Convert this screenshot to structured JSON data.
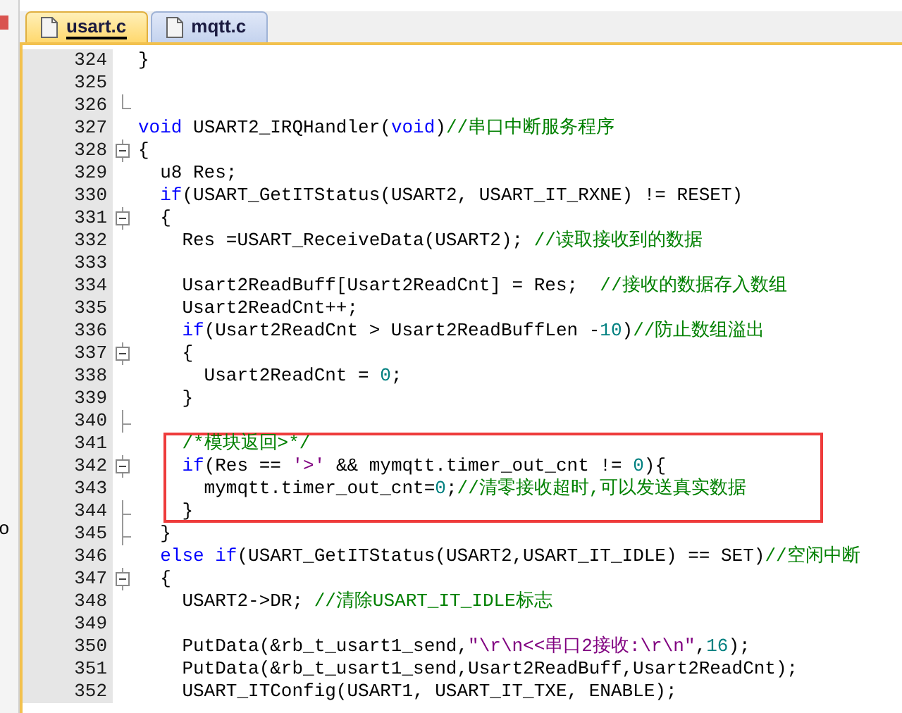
{
  "side_panel": {
    "text": "o"
  },
  "tabs": [
    {
      "label": "usart.c",
      "selected": true
    },
    {
      "label": "mqtt.c",
      "selected": false
    }
  ],
  "lines": [
    {
      "number": "324",
      "kind": "guide",
      "highlighted": false,
      "tokens": [
        {
          "kind": "plain",
          "text": "}"
        }
      ]
    },
    {
      "number": "325",
      "kind": "guide",
      "highlighted": false
    },
    {
      "number": "326",
      "kind": "end",
      "highlighted": false
    },
    {
      "number": "327",
      "kind": "plain",
      "highlighted": false,
      "tokens": [
        {
          "kind": "keyword",
          "text": "void"
        },
        {
          "kind": "plain",
          "text": " USART2_IRQHandler("
        },
        {
          "kind": "keyword",
          "text": "void"
        },
        {
          "kind": "plain",
          "text": ")"
        },
        {
          "kind": "comment",
          "text": "//串口中断服务程序"
        }
      ]
    },
    {
      "number": "328",
      "kind": "open",
      "highlighted": false,
      "tokens": [
        {
          "kind": "plain",
          "text": "{"
        }
      ]
    },
    {
      "number": "329",
      "kind": "guide",
      "highlighted": false,
      "tokens": [
        {
          "kind": "plain",
          "text": "  u8 Res;"
        }
      ]
    },
    {
      "number": "330",
      "kind": "guide",
      "highlighted": false,
      "tokens": [
        {
          "kind": "keyword",
          "text": "  if"
        },
        {
          "kind": "plain",
          "text": "(USART_GetITStatus(USART2, USART_IT_RXNE) != RESET)"
        }
      ]
    },
    {
      "number": "331",
      "kind": "open",
      "highlighted": false,
      "tokens": [
        {
          "kind": "plain",
          "text": "  {"
        }
      ]
    },
    {
      "number": "332",
      "kind": "guide",
      "highlighted": false,
      "tokens": [
        {
          "kind": "plain",
          "text": "    Res =USART_ReceiveData(USART2); "
        },
        {
          "kind": "comment",
          "text": "//读取接收到的数据"
        }
      ]
    },
    {
      "number": "333",
      "kind": "guide",
      "highlighted": false
    },
    {
      "number": "334",
      "kind": "guide",
      "highlighted": false,
      "tokens": [
        {
          "kind": "plain",
          "text": "    Usart2ReadBuff[Usart2ReadCnt] = Res;  "
        },
        {
          "kind": "comment",
          "text": "//接收的数据存入数组"
        }
      ]
    },
    {
      "number": "335",
      "kind": "guide",
      "highlighted": false,
      "tokens": [
        {
          "kind": "plain",
          "text": "    Usart2ReadCnt++;"
        }
      ]
    },
    {
      "number": "336",
      "kind": "guide",
      "highlighted": false,
      "tokens": [
        {
          "kind": "keyword",
          "text": "    if"
        },
        {
          "kind": "plain",
          "text": "(Usart2ReadCnt > Usart2ReadBuffLen -"
        },
        {
          "kind": "number",
          "text": "10"
        },
        {
          "kind": "plain",
          "text": ")"
        },
        {
          "kind": "comment",
          "text": "//防止数组溢出"
        }
      ]
    },
    {
      "number": "337",
      "kind": "open",
      "highlighted": false,
      "tokens": [
        {
          "kind": "plain",
          "text": "    {"
        }
      ]
    },
    {
      "number": "338",
      "kind": "guide",
      "highlighted": false,
      "tokens": [
        {
          "kind": "plain",
          "text": "      Usart2ReadCnt = "
        },
        {
          "kind": "number",
          "text": "0"
        },
        {
          "kind": "plain",
          "text": ";"
        }
      ]
    },
    {
      "number": "339",
      "kind": "guide",
      "highlighted": false,
      "tokens": [
        {
          "kind": "plain",
          "text": "    }"
        }
      ]
    },
    {
      "number": "340",
      "kind": "tick",
      "highlighted": false
    },
    {
      "number": "341",
      "kind": "guide",
      "highlighted": true,
      "tokens": [
        {
          "kind": "comment",
          "text": "    /*模块返回>*/"
        }
      ]
    },
    {
      "number": "342",
      "kind": "open",
      "highlighted": true,
      "tokens": [
        {
          "kind": "keyword",
          "text": "    if"
        },
        {
          "kind": "plain",
          "text": "(Res == "
        },
        {
          "kind": "string",
          "text": "'>'"
        },
        {
          "kind": "plain",
          "text": " && mymqtt.timer_out_cnt != "
        },
        {
          "kind": "number",
          "text": "0"
        },
        {
          "kind": "plain",
          "text": "){"
        }
      ]
    },
    {
      "number": "343",
      "kind": "guide",
      "highlighted": true,
      "tokens": [
        {
          "kind": "plain",
          "text": "      mymqtt.timer_out_cnt="
        },
        {
          "kind": "number",
          "text": "0"
        },
        {
          "kind": "plain",
          "text": ";"
        },
        {
          "kind": "comment",
          "text": "//清零接收超时,可以发送真实数据"
        }
      ]
    },
    {
      "number": "344",
      "kind": "tick",
      "highlighted": true,
      "tokens": [
        {
          "kind": "plain",
          "text": "    }"
        }
      ]
    },
    {
      "number": "345",
      "kind": "tick",
      "highlighted": false,
      "tokens": [
        {
          "kind": "plain",
          "text": "  }"
        }
      ]
    },
    {
      "number": "346",
      "kind": "guide",
      "highlighted": false,
      "tokens": [
        {
          "kind": "keyword",
          "text": "  else if"
        },
        {
          "kind": "plain",
          "text": "(USART_GetITStatus(USART2,USART_IT_IDLE) == SET)"
        },
        {
          "kind": "comment",
          "text": "//空闲中断"
        }
      ]
    },
    {
      "number": "347",
      "kind": "open",
      "highlighted": false,
      "tokens": [
        {
          "kind": "plain",
          "text": "  {"
        }
      ]
    },
    {
      "number": "348",
      "kind": "guide",
      "highlighted": false,
      "tokens": [
        {
          "kind": "plain",
          "text": "    USART2->DR; "
        },
        {
          "kind": "comment",
          "text": "//清除USART_IT_IDLE标志"
        }
      ]
    },
    {
      "number": "349",
      "kind": "guide",
      "highlighted": false
    },
    {
      "number": "350",
      "kind": "guide",
      "highlighted": false,
      "tokens": [
        {
          "kind": "plain",
          "text": "    PutData(&rb_t_usart1_send,"
        },
        {
          "kind": "string",
          "text": "\"\\r\\n<<串口2接收:\\r\\n\""
        },
        {
          "kind": "plain",
          "text": ","
        },
        {
          "kind": "number",
          "text": "16"
        },
        {
          "kind": "plain",
          "text": ");"
        }
      ]
    },
    {
      "number": "351",
      "kind": "guide",
      "highlighted": false,
      "tokens": [
        {
          "kind": "plain",
          "text": "    PutData(&rb_t_usart1_send,Usart2ReadBuff,Usart2ReadCnt);"
        }
      ]
    },
    {
      "number": "352",
      "kind": "guide",
      "highlighted": false,
      "tokens": [
        {
          "kind": "plain",
          "text": "    USART_ITConfig(USART1, USART_IT_TXE, ENABLE);"
        }
      ]
    }
  ]
}
